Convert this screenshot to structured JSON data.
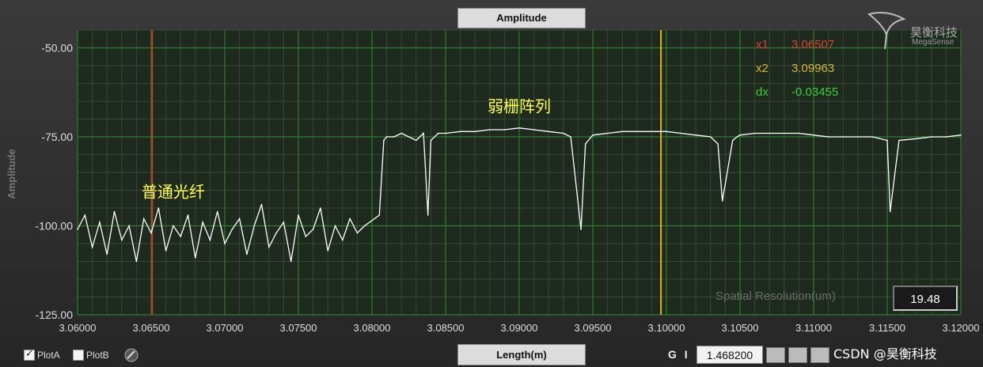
{
  "top_tab": "Amplitude",
  "bottom_tab": "Length(m)",
  "chart_data": {
    "type": "line",
    "title": "Amplitude",
    "xlabel": "Length(m)",
    "ylabel": "Amplitude",
    "xlim": [
      3.06,
      3.12
    ],
    "ylim": [
      -125,
      -45
    ],
    "x_ticks": [
      "3.06000",
      "3.06500",
      "3.07000",
      "3.07500",
      "3.08000",
      "3.08500",
      "3.09000",
      "3.09500",
      "3.10000",
      "3.10500",
      "3.11000",
      "3.11500",
      "3.12000"
    ],
    "x_tick_values": [
      3.06,
      3.065,
      3.07,
      3.075,
      3.08,
      3.085,
      3.09,
      3.095,
      3.1,
      3.105,
      3.11,
      3.115,
      3.12
    ],
    "y_ticks": [
      "-50.00",
      "-75.00",
      "-100.00",
      "-125.00"
    ],
    "y_tick_values": [
      -50,
      -75,
      -100,
      -125
    ],
    "grid": true,
    "series": [
      {
        "color": "#ffffff",
        "x": [
          3.06,
          3.0605,
          3.061,
          3.0615,
          3.062,
          3.0625,
          3.063,
          3.0635,
          3.064,
          3.0645,
          3.065,
          3.0655,
          3.066,
          3.0665,
          3.067,
          3.0675,
          3.068,
          3.0685,
          3.069,
          3.0695,
          3.07,
          3.0705,
          3.071,
          3.0715,
          3.072,
          3.0725,
          3.073,
          3.0735,
          3.074,
          3.0745,
          3.075,
          3.0755,
          3.076,
          3.0765,
          3.077,
          3.0775,
          3.078,
          3.0785,
          3.079,
          3.0795,
          3.0805,
          3.0808,
          3.081,
          3.0815,
          3.082,
          3.0825,
          3.083,
          3.0835,
          3.0838,
          3.084,
          3.0845,
          3.085,
          3.086,
          3.087,
          3.088,
          3.089,
          3.09,
          3.091,
          3.092,
          3.093,
          3.0935,
          3.0942,
          3.0945,
          3.095,
          3.096,
          3.097,
          3.098,
          3.099,
          3.1,
          3.101,
          3.102,
          3.103,
          3.1035,
          3.1038,
          3.1045,
          3.1048,
          3.105,
          3.106,
          3.107,
          3.108,
          3.109,
          3.11,
          3.111,
          3.112,
          3.113,
          3.114,
          3.115,
          3.1152,
          3.1158,
          3.117,
          3.118,
          3.119,
          3.12
        ],
        "y": [
          -101,
          -97,
          -106,
          -99,
          -108,
          -96,
          -104,
          -100,
          -110,
          -98,
          -102,
          -95,
          -107,
          -100,
          -103,
          -97,
          -109,
          -99,
          -104,
          -96,
          -105,
          -101,
          -98,
          -108,
          -100,
          -94,
          -106,
          -102,
          -99,
          -110,
          -97,
          -103,
          -101,
          -95,
          -107,
          -100,
          -104,
          -98,
          -102,
          -100,
          -97,
          -76,
          -75,
          -75,
          -74,
          -75,
          -76,
          -74,
          -97,
          -76,
          -74,
          -74,
          -73.5,
          -73.5,
          -73,
          -73,
          -72.5,
          -73,
          -73.5,
          -74,
          -75,
          -101,
          -77,
          -74.5,
          -74,
          -73.5,
          -73.5,
          -73.5,
          -73.5,
          -74,
          -74.5,
          -75,
          -77,
          -93,
          -76,
          -75,
          -74.5,
          -74,
          -74,
          -74,
          -74,
          -74.5,
          -75,
          -75,
          -75,
          -75,
          -76,
          -96,
          -76,
          -75.5,
          -75,
          -75,
          -74.5
        ]
      }
    ],
    "cursors": [
      {
        "name": "x1",
        "x": 3.06507,
        "color": "#c33a2a"
      },
      {
        "name": "x2",
        "x": 3.09963,
        "color": "#e0b32a"
      }
    ],
    "readout": [
      {
        "label": "x1",
        "value": "3.06507",
        "color": "#d8443a"
      },
      {
        "label": "x2",
        "value": "3.09963",
        "color": "#d8b83a"
      },
      {
        "label": "dx",
        "value": "-0.03455",
        "color": "#3ccf3c"
      }
    ],
    "annotations": [
      {
        "text": "普通光纤",
        "x": 3.0665,
        "y": -92,
        "color": "#ffff55"
      },
      {
        "text": "弱栅阵列",
        "x": 3.09,
        "y": -68,
        "color": "#ffff55"
      }
    ],
    "axis_label_color": "#dddddd",
    "plot_bg": "#1e2a1e",
    "grid_major": "#2e7a2e",
    "grid_minor": "#3a453a"
  },
  "spatial_resolution": {
    "label": "Spatial Resolution(um)",
    "value": "19.48"
  },
  "legend": {
    "plot_a": "PlotA",
    "plot_b": "PlotB"
  },
  "toolbar": {
    "gi_label": "G I",
    "zoom_value": "1.468200"
  },
  "logo": {
    "cn": "昊衡科技",
    "en": "MegaSense"
  },
  "watermark": "CSDN @昊衡科技"
}
